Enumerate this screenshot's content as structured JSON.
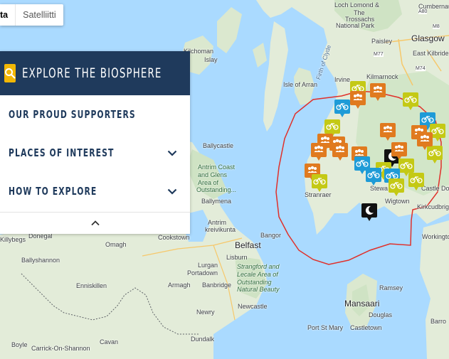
{
  "map_type": {
    "map_label": "ta",
    "satellite_label": "Satelliitti"
  },
  "panel": {
    "title": "EXPLORE THE BIOSPHERE",
    "items": [
      {
        "label": "OUR PROUD SUPPORTERS"
      },
      {
        "label": "PLACES OF INTEREST"
      },
      {
        "label": "HOW TO EXPLORE"
      }
    ]
  },
  "places": {
    "loch_lomond": "Loch Lomond &",
    "the_trossachs": "The",
    "trossachs": "Trossachs",
    "national_park": "National Park",
    "glasgow": "Glasgow",
    "paisley": "Paisley",
    "east_kilbride": "East Kilbride",
    "cumbernauld": "Cumbernauld",
    "kilchoman": "Kilchoman",
    "islay": "Islay",
    "isle_of_arran": "Isle of Arran",
    "firth_of_clyde": "Firth of Clyde",
    "irvine": "Irvine",
    "kilmarnock": "Kilmarnock",
    "ballycastle": "Ballycastle",
    "antrim_1": "Antrim Coast",
    "antrim_2": "and Glens",
    "antrim_3": "Area of",
    "antrim_4": "Outstanding...",
    "ballymena": "Ballymena",
    "antrim": "Antrim",
    "kreivikunta": "kreivikunta",
    "bangor": "Bangor",
    "belfast": "Belfast",
    "lisburn": "Lisburn",
    "lurgan": "Lurgan",
    "portadown": "Portadown",
    "armagh": "Armagh",
    "banbridge": "Banbridge",
    "newry": "Newry",
    "dundalk": "Dundalk",
    "newcastle": "Newcastle",
    "strangford_1": "Strangford and",
    "strangford_2": "Lecale Area of",
    "strangford_3": "Outstanding",
    "strangford_4": "Natural Beauty",
    "cookstown": "Cookstown",
    "omagh": "Omagh",
    "donegal": "Donegal",
    "killybegs": "Killybegs",
    "ballyshannon": "Ballyshannon",
    "enniskillen": "Enniskillen",
    "cavan": "Cavan",
    "carrick": "Carrick-On-Shannon",
    "boyle": "Boyle",
    "stranraer": "Stranraer",
    "wigtown": "Wigtown",
    "stewartry": "Stewa",
    "castle_douglas": "Castle Dou",
    "kirkcudbright": "Kirkcudbright",
    "workington": "Workingto",
    "mansaari": "Mansaari",
    "ramsey": "Ramsey",
    "douglas": "Douglas",
    "port_st_mary": "Port St Mary",
    "castletown": "Castletown",
    "barro": "Barro",
    "road_a80": "A80",
    "road_m8": "M8",
    "road_m77": "M77",
    "road_m74": "M74"
  },
  "colors": {
    "panel_header": "#1f3a5c",
    "search_accent": "#f2b705",
    "boundary": "#e0302a",
    "marker_orange": "#e07a1f",
    "marker_blue": "#1e9bd7",
    "marker_lime": "#c4c915",
    "marker_black": "#111111",
    "water": "#aadaff",
    "land": "#e8eee1"
  },
  "icons": {
    "search": "search-icon",
    "chevron": "chevron-down-icon",
    "collapse": "chevron-up-icon",
    "marker_types": [
      "group-icon",
      "bicycle-icon",
      "moon-icon"
    ]
  }
}
